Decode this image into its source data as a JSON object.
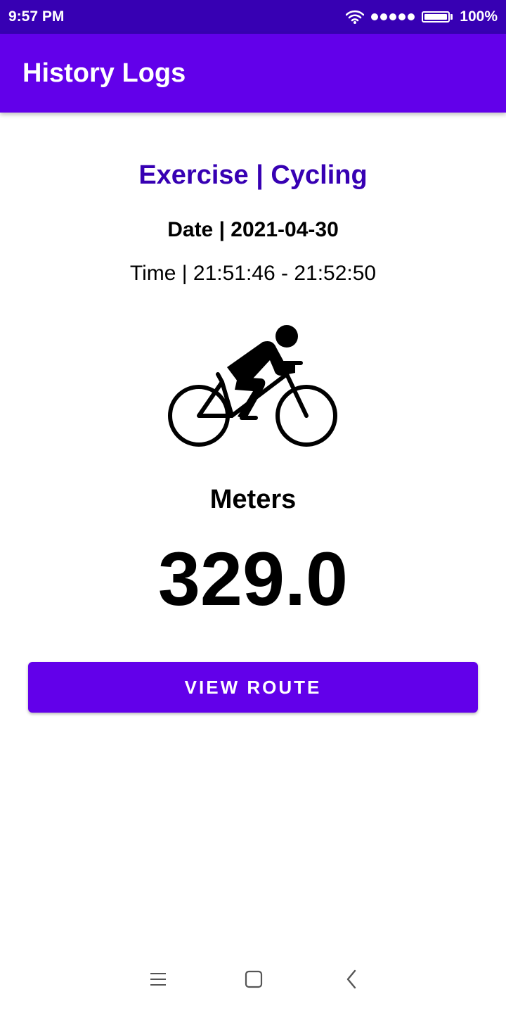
{
  "status_bar": {
    "time": "9:57 PM",
    "battery": "100%",
    "icons": [
      "wifi-icon",
      "signal-icon",
      "battery-icon"
    ]
  },
  "app_bar": {
    "title": "History Logs"
  },
  "log": {
    "exercise": "Exercise | Cycling",
    "date": "Date | 2021-04-30",
    "time": "Time | 21:51:46 - 21:52:50",
    "icon": "cycling-icon",
    "metric_label": "Meters",
    "metric_value": "329.0"
  },
  "actions": {
    "view_route_label": "VIEW ROUTE"
  },
  "nav_bar": {
    "icons": [
      "menu-icon",
      "home-icon",
      "back-icon"
    ]
  },
  "colors": {
    "status_bar": "#3700b3",
    "primary": "#6200ea",
    "title_text": "#3700b3"
  }
}
